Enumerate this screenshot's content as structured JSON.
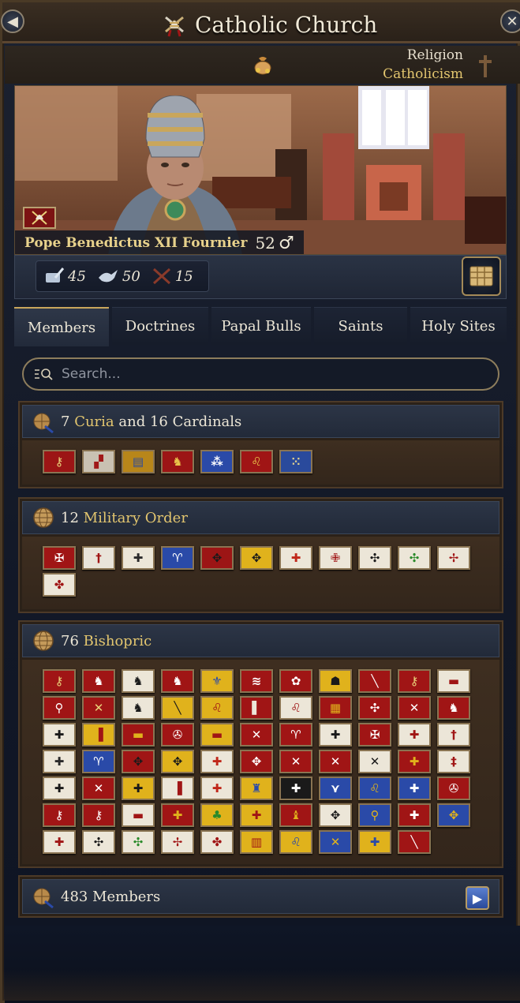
{
  "window": {
    "title": "Catholic Church",
    "back_icon": "back-arrow-icon",
    "close_icon": "close-x-icon"
  },
  "religion": {
    "label": "Religion",
    "value": "Catholicism"
  },
  "ruler": {
    "name": "Pope Benedictus XII Fournier",
    "age": "52",
    "sex_symbol": "♂"
  },
  "stats": [
    {
      "icon": "quill-scroll-icon",
      "value": "45"
    },
    {
      "icon": "dove-icon",
      "value": "50"
    },
    {
      "icon": "crossed-swords-icon",
      "value": "15"
    }
  ],
  "tabs": [
    {
      "label": "Members",
      "active": true
    },
    {
      "label": "Doctrines",
      "active": false
    },
    {
      "label": "Papal Bulls",
      "active": false
    },
    {
      "label": "Saints",
      "active": false
    },
    {
      "label": "Holy Sites",
      "active": false
    }
  ],
  "search": {
    "placeholder": "Search..."
  },
  "sections": [
    {
      "count": "7",
      "highlight": "Curia",
      "text_after": " and 16 Cardinals",
      "flags": [
        {
          "bg": "#9c1515",
          "fg": "#e9d27a",
          "glyph": "⚷"
        },
        {
          "bg": "#c9c1b2",
          "fg": "#a01818",
          "glyph": "▞"
        },
        {
          "bg": "#b8861a",
          "fg": "#2a4aa0",
          "glyph": "▤"
        },
        {
          "bg": "#9c1515",
          "fg": "#e9c34a",
          "glyph": "♞"
        },
        {
          "bg": "#2a4aa8",
          "fg": "#ffffff",
          "glyph": "⁂"
        },
        {
          "bg": "#a01515",
          "fg": "#e9c34a",
          "glyph": "♌"
        },
        {
          "bg": "#2a4a9c",
          "fg": "#e0d090",
          "glyph": "⁙"
        }
      ]
    },
    {
      "count": "12",
      "highlight": "Military Order",
      "text_after": "",
      "flags": [
        {
          "bg": "#a01515",
          "fg": "#ffffff",
          "glyph": "✠"
        },
        {
          "bg": "#e9e4da",
          "fg": "#a01515",
          "glyph": "†"
        },
        {
          "bg": "#ece6d8",
          "fg": "#2a2a2a",
          "glyph": "✚"
        },
        {
          "bg": "#2a4aa8",
          "fg": "#ffffff",
          "glyph": "♈"
        },
        {
          "bg": "#9c1515",
          "fg": "#1a1a1a",
          "glyph": "✥"
        },
        {
          "bg": "#e0b21c",
          "fg": "#1a1a1a",
          "glyph": "✥"
        },
        {
          "bg": "#ece6d8",
          "fg": "#c0271a",
          "glyph": "✚"
        },
        {
          "bg": "#ece6d8",
          "fg": "#a01515",
          "glyph": "✙"
        },
        {
          "bg": "#ece6d8",
          "fg": "#1a1a1a",
          "glyph": "✣"
        },
        {
          "bg": "#ece6d8",
          "fg": "#2a8a2a",
          "glyph": "✣"
        },
        {
          "bg": "#ece6d8",
          "fg": "#a01515",
          "glyph": "✢"
        },
        {
          "bg": "#ece6d8",
          "fg": "#a01515",
          "glyph": "✤"
        }
      ]
    },
    {
      "count": "76",
      "highlight": "Bishopric",
      "text_after": "",
      "flags": [
        {
          "bg": "#a01515",
          "fg": "#e9d27a",
          "glyph": "⚷"
        },
        {
          "bg": "#a01515",
          "fg": "#ffffff",
          "glyph": "♞"
        },
        {
          "bg": "#ece6d8",
          "fg": "#1a1a1a",
          "glyph": "♞"
        },
        {
          "bg": "#a01515",
          "fg": "#ffffff",
          "glyph": "♞"
        },
        {
          "bg": "#e0b21c",
          "fg": "#2a4aa8",
          "glyph": "⚜"
        },
        {
          "bg": "#a01515",
          "fg": "#ffffff",
          "glyph": "≋"
        },
        {
          "bg": "#a01515",
          "fg": "#ffffff",
          "glyph": "✿"
        },
        {
          "bg": "#e0b21c",
          "fg": "#1a1a1a",
          "glyph": "☗"
        },
        {
          "bg": "#a01515",
          "fg": "#ffffff",
          "glyph": "╲"
        },
        {
          "bg": "#a01515",
          "fg": "#e9d27a",
          "glyph": "⚷"
        },
        {
          "bg": "#ece6d8",
          "fg": "#a01515",
          "glyph": "▬"
        },
        {
          "bg": "#a01515",
          "fg": "#ffffff",
          "glyph": "⚲"
        },
        {
          "bg": "#a01515",
          "fg": "#e9d27a",
          "glyph": "✕"
        },
        {
          "bg": "#ece6d8",
          "fg": "#1a1a1a",
          "glyph": "♞"
        },
        {
          "bg": "#e0b21c",
          "fg": "#1a1a1a",
          "glyph": "╲"
        },
        {
          "bg": "#e0b21c",
          "fg": "#a01515",
          "glyph": "♌"
        },
        {
          "bg": "#a01515",
          "fg": "#ece6d8",
          "glyph": "▌"
        },
        {
          "bg": "#ece6d8",
          "fg": "#a01515",
          "glyph": "♌"
        },
        {
          "bg": "#a01515",
          "fg": "#e0b21c",
          "glyph": "▦"
        },
        {
          "bg": "#a01515",
          "fg": "#ffffff",
          "glyph": "✣"
        },
        {
          "bg": "#a01515",
          "fg": "#ffffff",
          "glyph": "✕"
        },
        {
          "bg": "#a01515",
          "fg": "#ffffff",
          "glyph": "♞"
        },
        {
          "bg": "#ece6d8",
          "fg": "#1a1a1a",
          "glyph": "✚"
        },
        {
          "bg": "#e0b21c",
          "fg": "#a01515",
          "glyph": "▐"
        },
        {
          "bg": "#a01515",
          "fg": "#e0b21c",
          "glyph": "▬"
        },
        {
          "bg": "#a01515",
          "fg": "#ffffff",
          "glyph": "✇"
        },
        {
          "bg": "#e0b21c",
          "fg": "#a01515",
          "glyph": "▬"
        },
        {
          "bg": "#a01515",
          "fg": "#ffffff",
          "glyph": "✕"
        },
        {
          "bg": "#a01515",
          "fg": "#ffffff",
          "glyph": "♈"
        },
        {
          "bg": "#ece6d8",
          "fg": "#1a1a1a",
          "glyph": "✚"
        },
        {
          "bg": "#a01515",
          "fg": "#ffffff",
          "glyph": "✠"
        },
        {
          "bg": "#ece6d8",
          "fg": "#a01515",
          "glyph": "✚"
        },
        {
          "bg": "#ece6d8",
          "fg": "#a01515",
          "glyph": "†"
        },
        {
          "bg": "#ece6d8",
          "fg": "#2a2a2a",
          "glyph": "✚"
        },
        {
          "bg": "#2a4aa8",
          "fg": "#ffffff",
          "glyph": "♈"
        },
        {
          "bg": "#a01515",
          "fg": "#1a1a1a",
          "glyph": "✥"
        },
        {
          "bg": "#e0b21c",
          "fg": "#1a1a1a",
          "glyph": "✥"
        },
        {
          "bg": "#ece6d8",
          "fg": "#c0271a",
          "glyph": "✚"
        },
        {
          "bg": "#a01515",
          "fg": "#ffffff",
          "glyph": "✥"
        },
        {
          "bg": "#a01515",
          "fg": "#ffffff",
          "glyph": "✕"
        },
        {
          "bg": "#a01515",
          "fg": "#ffffff",
          "glyph": "✕"
        },
        {
          "bg": "#ece6d8",
          "fg": "#1a1a1a",
          "glyph": "✕"
        },
        {
          "bg": "#a01515",
          "fg": "#e0b21c",
          "glyph": "✚"
        },
        {
          "bg": "#ece6d8",
          "fg": "#a01515",
          "glyph": "‡"
        },
        {
          "bg": "#ece6d8",
          "fg": "#1a1a1a",
          "glyph": "✚"
        },
        {
          "bg": "#a01515",
          "fg": "#ffffff",
          "glyph": "✕"
        },
        {
          "bg": "#e0b21c",
          "fg": "#1a1a1a",
          "glyph": "✚"
        },
        {
          "bg": "#ece6d8",
          "fg": "#a01515",
          "glyph": "▐"
        },
        {
          "bg": "#ece6d8",
          "fg": "#c0271a",
          "glyph": "✚"
        },
        {
          "bg": "#e0b21c",
          "fg": "#2a4aa8",
          "glyph": "♜"
        },
        {
          "bg": "#1a1a1a",
          "fg": "#ffffff",
          "glyph": "✚"
        },
        {
          "bg": "#2a4aa8",
          "fg": "#ffffff",
          "glyph": "⋎"
        },
        {
          "bg": "#2a4aa8",
          "fg": "#e0b21c",
          "glyph": "♌"
        },
        {
          "bg": "#2a4aa8",
          "fg": "#ffffff",
          "glyph": "✚"
        },
        {
          "bg": "#a01515",
          "fg": "#ffffff",
          "glyph": "✇"
        },
        {
          "bg": "#a01515",
          "fg": "#ffffff",
          "glyph": "⚷"
        },
        {
          "bg": "#a01515",
          "fg": "#ffffff",
          "glyph": "⚷"
        },
        {
          "bg": "#ece6d8",
          "fg": "#a01515",
          "glyph": "▬"
        },
        {
          "bg": "#a01515",
          "fg": "#e0b21c",
          "glyph": "✚"
        },
        {
          "bg": "#e0b21c",
          "fg": "#2a8a2a",
          "glyph": "♣"
        },
        {
          "bg": "#e0b21c",
          "fg": "#a01515",
          "glyph": "✚"
        },
        {
          "bg": "#a01515",
          "fg": "#e0b21c",
          "glyph": "♝"
        },
        {
          "bg": "#ece6d8",
          "fg": "#1a1a1a",
          "glyph": "✥"
        },
        {
          "bg": "#2a4aa8",
          "fg": "#e0b21c",
          "glyph": "⚲"
        },
        {
          "bg": "#a01515",
          "fg": "#ffffff",
          "glyph": "✚"
        },
        {
          "bg": "#2a4aa8",
          "fg": "#e0b21c",
          "glyph": "✥"
        },
        {
          "bg": "#ece6d8",
          "fg": "#a01515",
          "glyph": "✚"
        },
        {
          "bg": "#ece6d8",
          "fg": "#1a1a1a",
          "glyph": "✣"
        },
        {
          "bg": "#ece6d8",
          "fg": "#2a8a2a",
          "glyph": "✣"
        },
        {
          "bg": "#ece6d8",
          "fg": "#a01515",
          "glyph": "✢"
        },
        {
          "bg": "#ece6d8",
          "fg": "#a01515",
          "glyph": "✤"
        },
        {
          "bg": "#e0b21c",
          "fg": "#a01515",
          "glyph": "▥"
        },
        {
          "bg": "#e0b21c",
          "fg": "#2a4aa8",
          "glyph": "♌"
        },
        {
          "bg": "#2a4aa8",
          "fg": "#e0b21c",
          "glyph": "✕"
        },
        {
          "bg": "#e0b21c",
          "fg": "#2a4aa8",
          "glyph": "✚"
        },
        {
          "bg": "#a01515",
          "fg": "#ffffff",
          "glyph": "╲"
        }
      ]
    }
  ],
  "members": {
    "text": "483 Members"
  }
}
